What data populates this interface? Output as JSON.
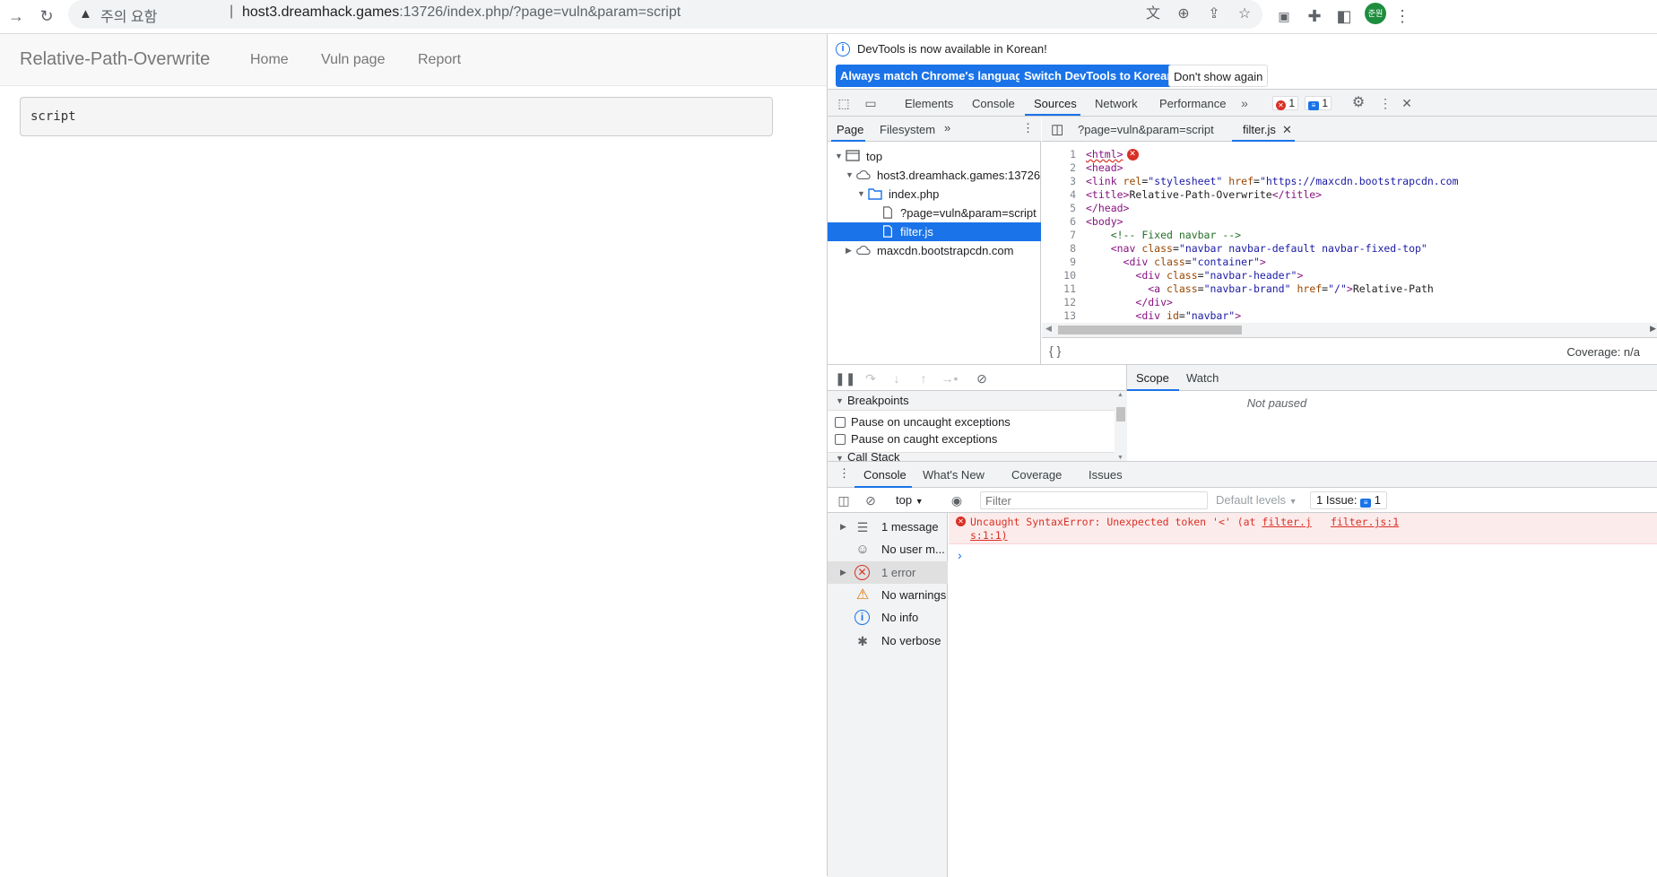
{
  "browser": {
    "security_status": "주의 요함",
    "url_host": "host3.dreamhack.games",
    "url_path": ":13726/index.php/?page=vuln&param=script",
    "profile_initials": "준원"
  },
  "page": {
    "brand": "Relative-Path-Overwrite",
    "nav": [
      "Home",
      "Vuln page",
      "Report"
    ],
    "param_value": "script"
  },
  "devtools": {
    "infobar": {
      "message": "DevTools is now available in Korean!",
      "btn_match": "Always match Chrome's language",
      "btn_switch": "Switch DevTools to Korean",
      "btn_dismiss": "Don't show again"
    },
    "tabs": [
      "Elements",
      "Console",
      "Sources",
      "Network",
      "Performance"
    ],
    "active_tab": "Sources",
    "error_count": "1",
    "issue_count": "1",
    "navigator": {
      "tabs": [
        "Page",
        "Filesystem"
      ],
      "tree": {
        "top": "top",
        "host": "host3.dreamhack.games:13726",
        "folder": "index.php",
        "file1": "?page=vuln&param=script",
        "file2": "filter.js",
        "cdn": "maxcdn.bootstrapcdn.com"
      }
    },
    "editor": {
      "tabs": [
        "?page=vuln&param=script",
        "filter.js"
      ],
      "line_numbers": [
        "1",
        "2",
        "3",
        "4",
        "5",
        "6",
        "7",
        "8",
        "9",
        "10",
        "11",
        "12",
        "13"
      ],
      "coverage": "Coverage: n/a"
    },
    "debugger": {
      "breakpoints_title": "Breakpoints",
      "pause_uncaught": "Pause on uncaught exceptions",
      "pause_caught": "Pause on caught exceptions",
      "call_stack": "Call Stack",
      "scope_tabs": [
        "Scope",
        "Watch"
      ],
      "not_paused": "Not paused"
    },
    "drawer": {
      "tabs": [
        "Console",
        "What's New",
        "Coverage",
        "Issues"
      ],
      "context": "top",
      "filter_placeholder": "Filter",
      "levels": "Default levels",
      "issues_label": "1 Issue:",
      "issues_count": "1",
      "sidebar": [
        "1 message",
        "No user m...",
        "1 error",
        "No warnings",
        "No info",
        "No verbose"
      ],
      "error_line1_a": "Uncaught SyntaxError: Unexpected token '<' (at ",
      "error_line1_link": "filter.j",
      "error_line2": "s:1:1)",
      "error_source": "filter.js:1"
    }
  }
}
